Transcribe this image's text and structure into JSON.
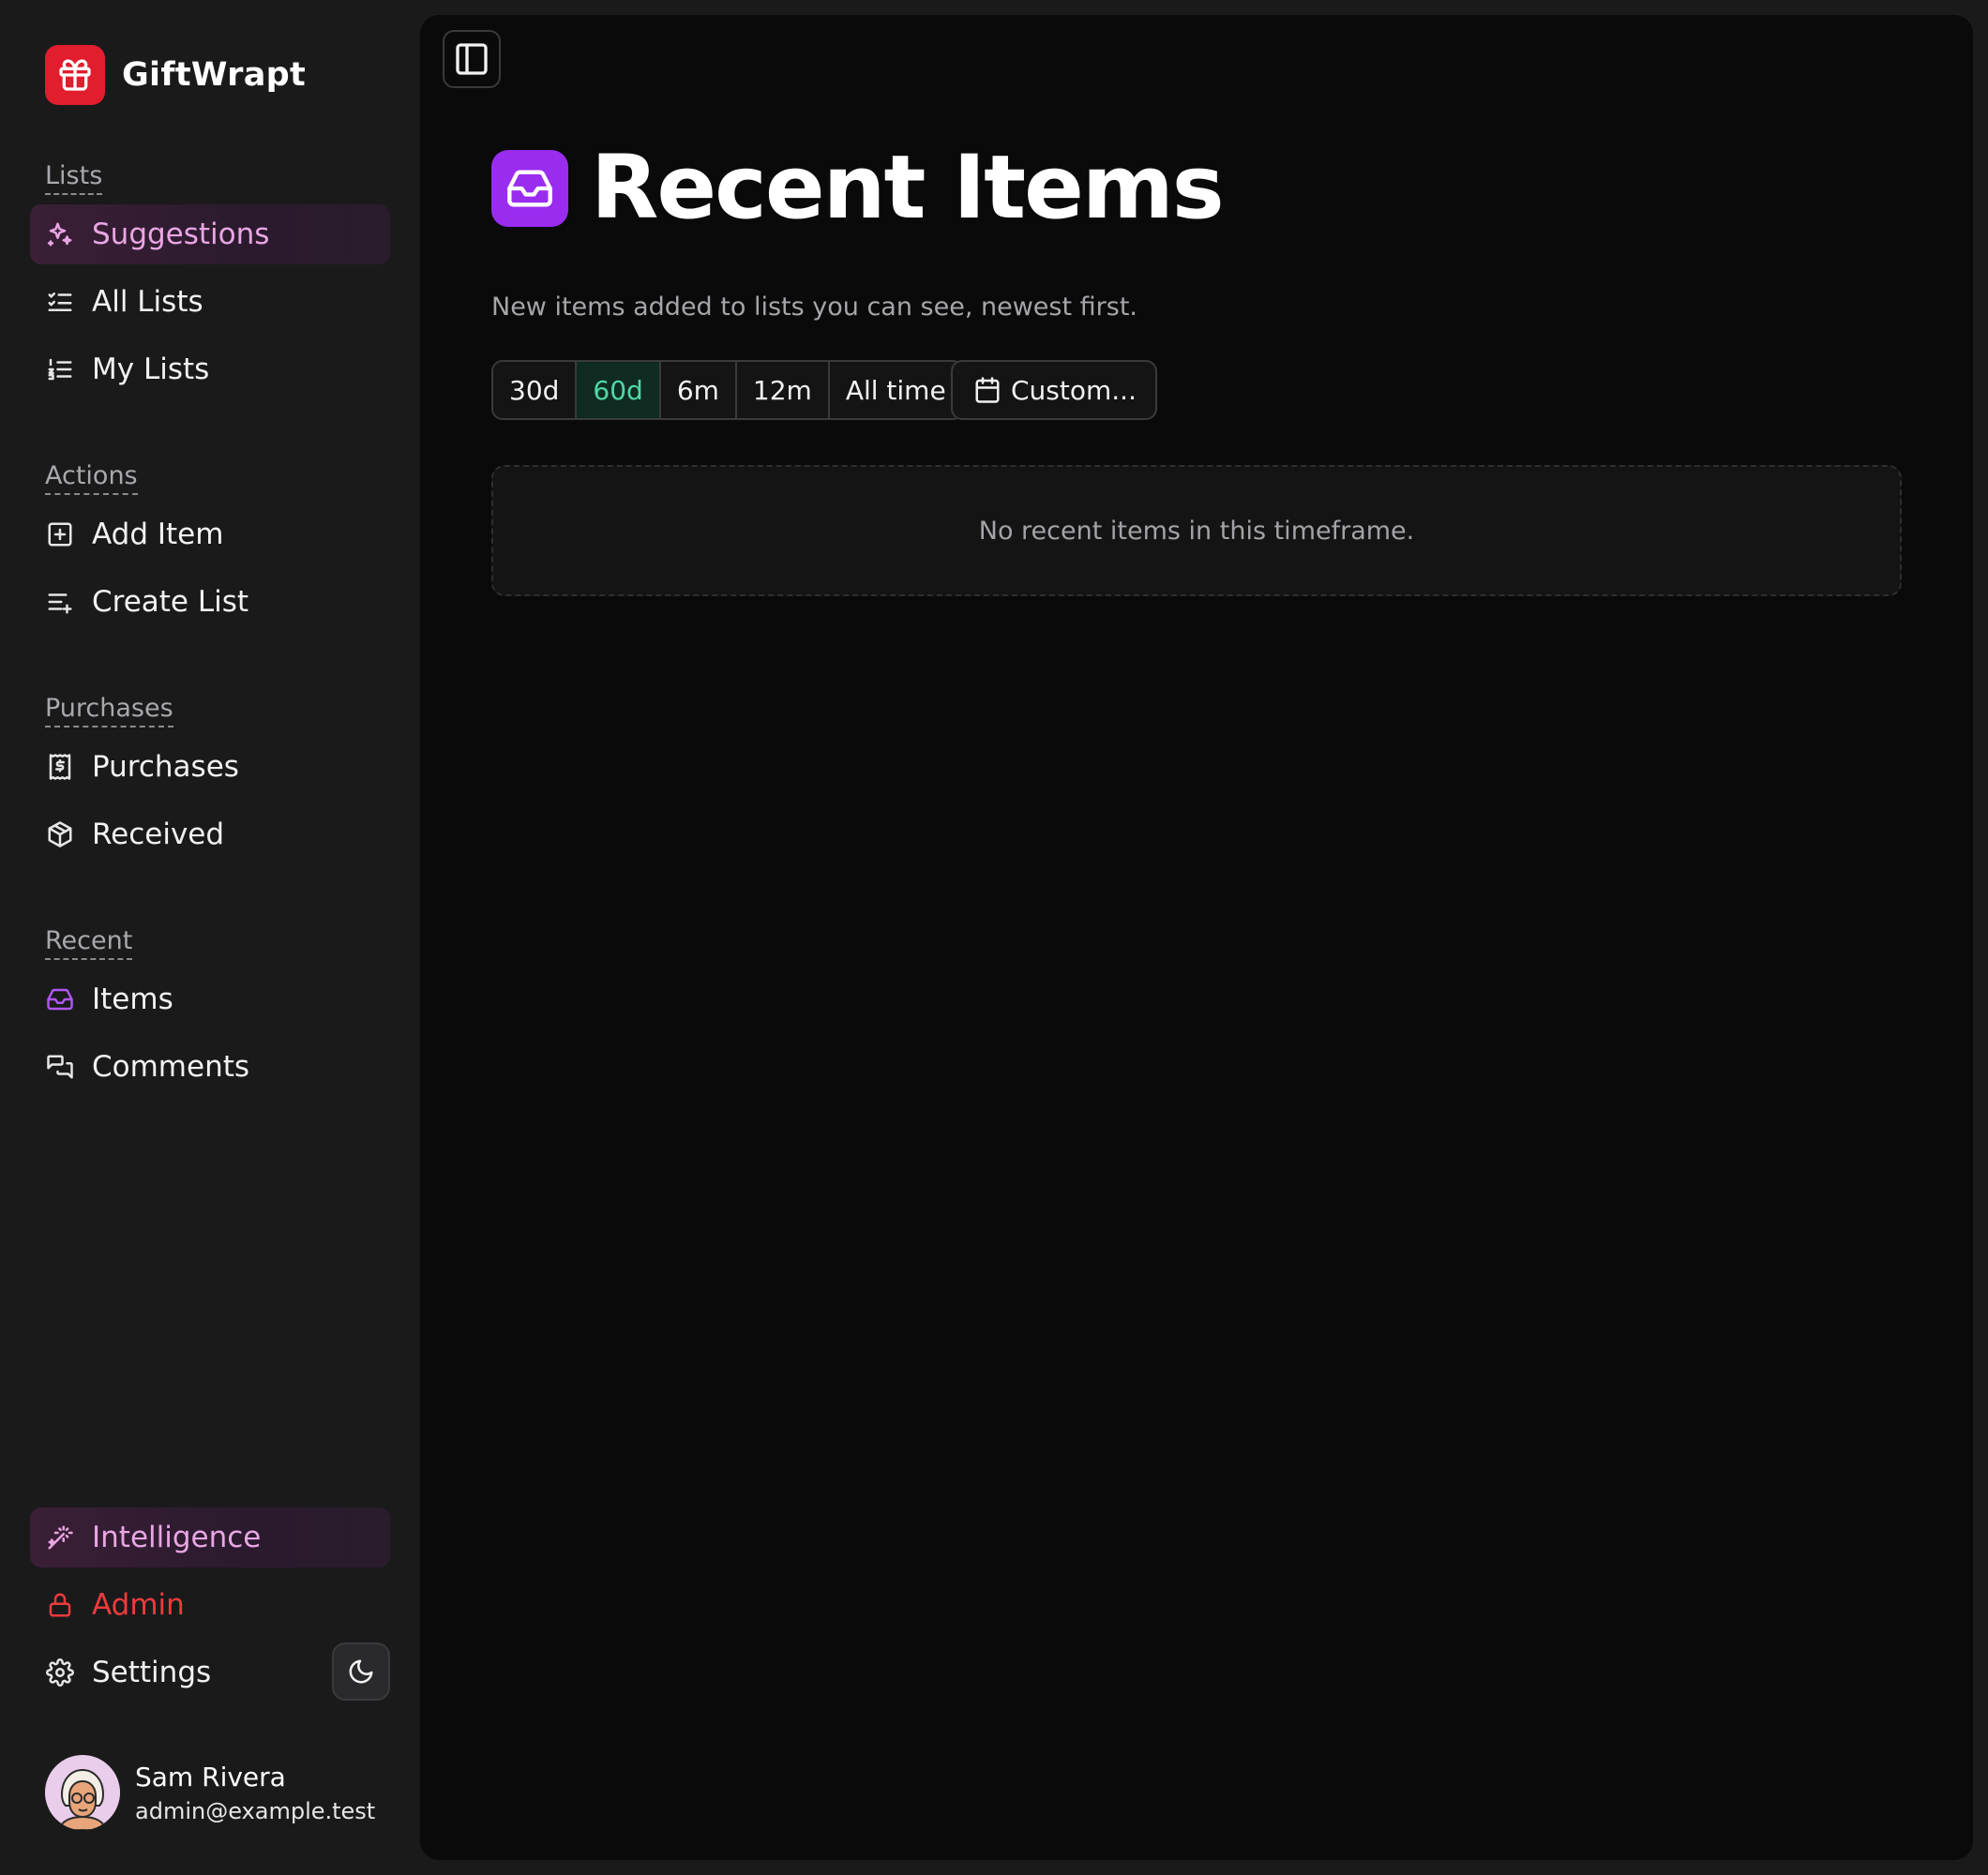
{
  "app": {
    "name": "GiftWrapt",
    "brand_color": "#e11d2e"
  },
  "sidebar": {
    "sections": [
      {
        "label": "Lists",
        "items": [
          {
            "label": "Suggestions",
            "icon": "sparkles-icon",
            "active": true
          },
          {
            "label": "All Lists",
            "icon": "list-checks-icon"
          },
          {
            "label": "My Lists",
            "icon": "list-ordered-icon"
          }
        ]
      },
      {
        "label": "Actions",
        "items": [
          {
            "label": "Add Item",
            "icon": "plus-square-icon"
          },
          {
            "label": "Create List",
            "icon": "list-plus-icon"
          }
        ]
      },
      {
        "label": "Purchases",
        "items": [
          {
            "label": "Purchases",
            "icon": "receipt-icon"
          },
          {
            "label": "Received",
            "icon": "package-icon"
          }
        ]
      },
      {
        "label": "Recent",
        "items": [
          {
            "label": "Items",
            "icon": "inbox-icon"
          },
          {
            "label": "Comments",
            "icon": "messages-icon"
          }
        ]
      }
    ],
    "bottom": {
      "intelligence": {
        "label": "Intelligence",
        "icon": "wand-icon",
        "active": true
      },
      "admin": {
        "label": "Admin",
        "icon": "lock-icon",
        "color": "#ef3b3b"
      },
      "settings": {
        "label": "Settings",
        "icon": "gear-icon"
      },
      "theme_toggle_icon": "moon-icon"
    },
    "user": {
      "name": "Sam Rivera",
      "email": "admin@example.test"
    }
  },
  "main": {
    "title": "Recent Items",
    "title_icon": "inbox-icon",
    "title_icon_color": "#9a2cf0",
    "subtitle": "New items added to lists you can see, newest first.",
    "ranges": [
      "30d",
      "60d",
      "6m",
      "12m",
      "All time"
    ],
    "selected_range": "60d",
    "custom_label": "Custom...",
    "empty_message": "No recent items in this timeframe."
  }
}
